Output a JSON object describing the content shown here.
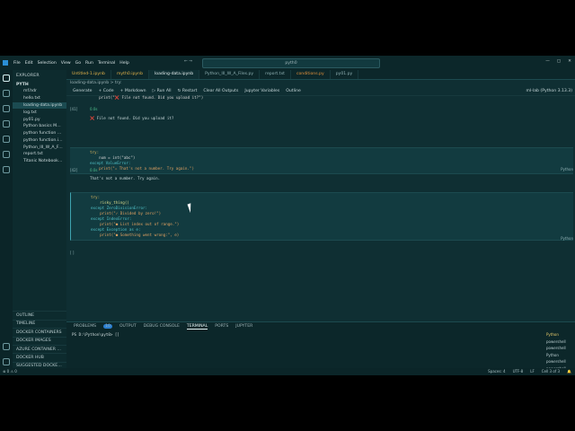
{
  "menu": [
    "File",
    "Edit",
    "Selection",
    "View",
    "Go",
    "Run",
    "Terminal",
    "Help"
  ],
  "search_text": "pyth0",
  "explorer": {
    "header": "EXPLORER",
    "folder": "PYTH",
    "files": [
      "mf.hdr",
      "hello.txt",
      "loading-data.ipynb",
      "log.txt",
      "py01.py",
      "Python basics ML coo...",
      "python function real...",
      "python function.ipynb",
      "Python_III_W_A_Files.py",
      "report.txt",
      "Titanic Notebook.ipynb"
    ],
    "sections": [
      "OUTLINE",
      "TIMELINE",
      "DOCKER CONTAINERS",
      "DOCKER IMAGES",
      "AZURE CONTAINER REGIS...",
      "DOCKER HUB",
      "SUGGESTED DOCKER HUB..."
    ]
  },
  "tabs": [
    "Untitled-1.ipynb",
    "myth0.ipynb",
    "loading-data.ipynb",
    "Python_III_W_A_Files.py",
    "report.txt",
    "conditions.py",
    "py01.py"
  ],
  "breadcrumb": "loading-data.ipynb  >  try:",
  "toolbar": {
    "generate": "Generate",
    "code": "+ Code",
    "markdown": "+ Markdown",
    "run_all": "▷ Run All",
    "restart": "↻ Restart",
    "clear": "Clear All Outputs",
    "variables": "Jupyter Variables",
    "outline": "Outline",
    "kernel": "ml-lab (Python 3.13.3)"
  },
  "cells": {
    "top_line": "    print(\"❌ File not found. Did you upload it?\")",
    "prompt1": "[41]",
    "status1": "0.0s",
    "out1": "❌ File not found. Did you upload it?",
    "c2": {
      "l1": "try:",
      "l2": "    num = int(\"abc\")",
      "l3": "except ValueError:",
      "l4": "    print(\"⚠ That's not a number. Try again.\")"
    },
    "prompt2": "[42]",
    "status2": "0.0s",
    "out2": "That's not a number. Try again.",
    "c3": {
      "l1": "try:",
      "l2": "    risky_thing()",
      "l3": "except ZeroDivisionError:",
      "l4": "    print(\"✓ Divided by zero!\")",
      "l5": "except IndexError:",
      "l6": "    print(\"● List index out of range.\")",
      "l7": "except Exception as e:",
      "l8": "    print(\"● Something went wrong:\", e)"
    },
    "prompt3": "[ ]",
    "lang": "Python"
  },
  "panel": {
    "tabs": [
      "PROBLEMS",
      "OUTPUT",
      "DEBUG CONSOLE",
      "TERMINAL",
      "PORTS",
      "JUPYTER"
    ],
    "problems_count": "10",
    "prompt": "PS D:\\Python\\pyt0> []",
    "terminals": [
      "Python",
      "powershell",
      "powershell",
      "Python",
      "powershell",
      "powershell"
    ]
  },
  "status": {
    "left": "⊗ 0 ⚠ 0",
    "spaces": "Spaces: 4",
    "encoding": "UTF-8",
    "eol": "LF",
    "cell": "Cell 3 of 3"
  }
}
